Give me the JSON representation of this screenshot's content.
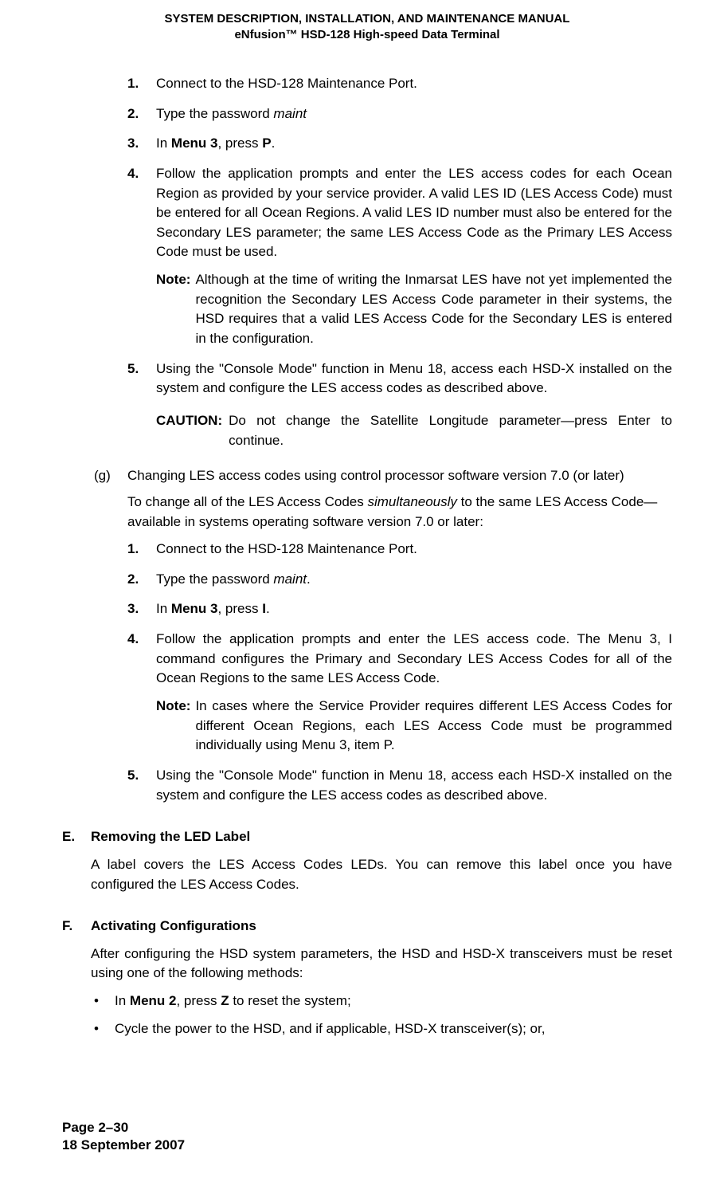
{
  "header": {
    "line1": "SYSTEM DESCRIPTION, INSTALLATION, AND MAINTENANCE MANUAL",
    "line2": "eNfusion™ HSD-128 High-speed Data Terminal"
  },
  "listA": {
    "items": [
      {
        "num": "1.",
        "text": "Connect to the HSD-128 Maintenance Port."
      },
      {
        "num": "2.",
        "prefix": "Type the password ",
        "italic": "maint"
      },
      {
        "num": "3.",
        "prefix": "In ",
        "bold1": "Menu 3",
        "mid": ", press ",
        "bold2": "P",
        "suffix": "."
      },
      {
        "num": "4.",
        "text": "Follow the application prompts and enter the LES access codes for each Ocean Region as provided by your service provider. A valid LES ID (LES Access Code) must be entered for all Ocean Regions. A valid LES ID number must also be entered for the Secondary LES parameter; the same LES Access Code as the Primary LES Access Code must be used.",
        "noteLabel": "Note:",
        "noteText": "Although at the time of writing the Inmarsat LES have not yet implemented the recognition the Secondary LES Access Code parameter in their systems, the HSD requires that a valid LES Access Code for the Secondary LES is entered in the configuration."
      },
      {
        "num": "5.",
        "text": "Using the \"Console Mode\" function in Menu 18, access each HSD-X installed on the system and configure the LES access codes as described above.",
        "cautionLabel": "CAUTION:",
        "cautionText": "Do not change the Satellite Longitude parameter—press Enter to continue."
      }
    ]
  },
  "letterG": {
    "marker": "(g)",
    "title": "Changing LES access codes using control processor software version 7.0 (or later)",
    "intro_pre": "To change all of the LES Access Codes ",
    "intro_italic": "simultaneously",
    "intro_post": " to the same LES Access Code—available in systems operating software version 7.0 or later:"
  },
  "listB": {
    "items": [
      {
        "num": "1.",
        "text": "Connect to the HSD-128 Maintenance Port."
      },
      {
        "num": "2.",
        "prefix": "Type the password ",
        "italic": "maint",
        "suffix": "."
      },
      {
        "num": "3.",
        "prefix": "In ",
        "bold1": "Menu 3",
        "mid": ", press ",
        "bold2": "I",
        "suffix": "."
      },
      {
        "num": "4.",
        "text": "Follow the application prompts and enter the LES access code. The Menu 3, I command configures the Primary and Secondary LES Access Codes for all of the Ocean Regions to the same LES Access Code.",
        "noteLabel": "Note:",
        "noteText": "In cases where the Service Provider requires different LES Access Codes for different Ocean Regions, each LES Access Code must be programmed individually using Menu 3, item P."
      },
      {
        "num": "5.",
        "text": "Using the \"Console Mode\" function in Menu 18, access each HSD-X installed on the system and configure the LES access codes as described above."
      }
    ]
  },
  "sectionE": {
    "letter": "E.",
    "title": "Removing the LED Label",
    "body": "A label covers the LES Access Codes LEDs. You can remove this label once you have configured the LES Access Codes."
  },
  "sectionF": {
    "letter": "F.",
    "title": "Activating Configurations",
    "body": "After configuring the HSD system parameters, the HSD and HSD-X transceivers must be reset using one of the following methods:",
    "bullet1_pre": "In ",
    "bullet1_bold1": "Menu 2",
    "bullet1_mid": ", press ",
    "bullet1_bold2": "Z",
    "bullet1_post": " to reset the system;",
    "bullet2": "Cycle the power to the HSD, and if applicable, HSD-X transceiver(s); or,"
  },
  "footer": {
    "page": "Page 2–30",
    "date": "18 September 2007"
  }
}
